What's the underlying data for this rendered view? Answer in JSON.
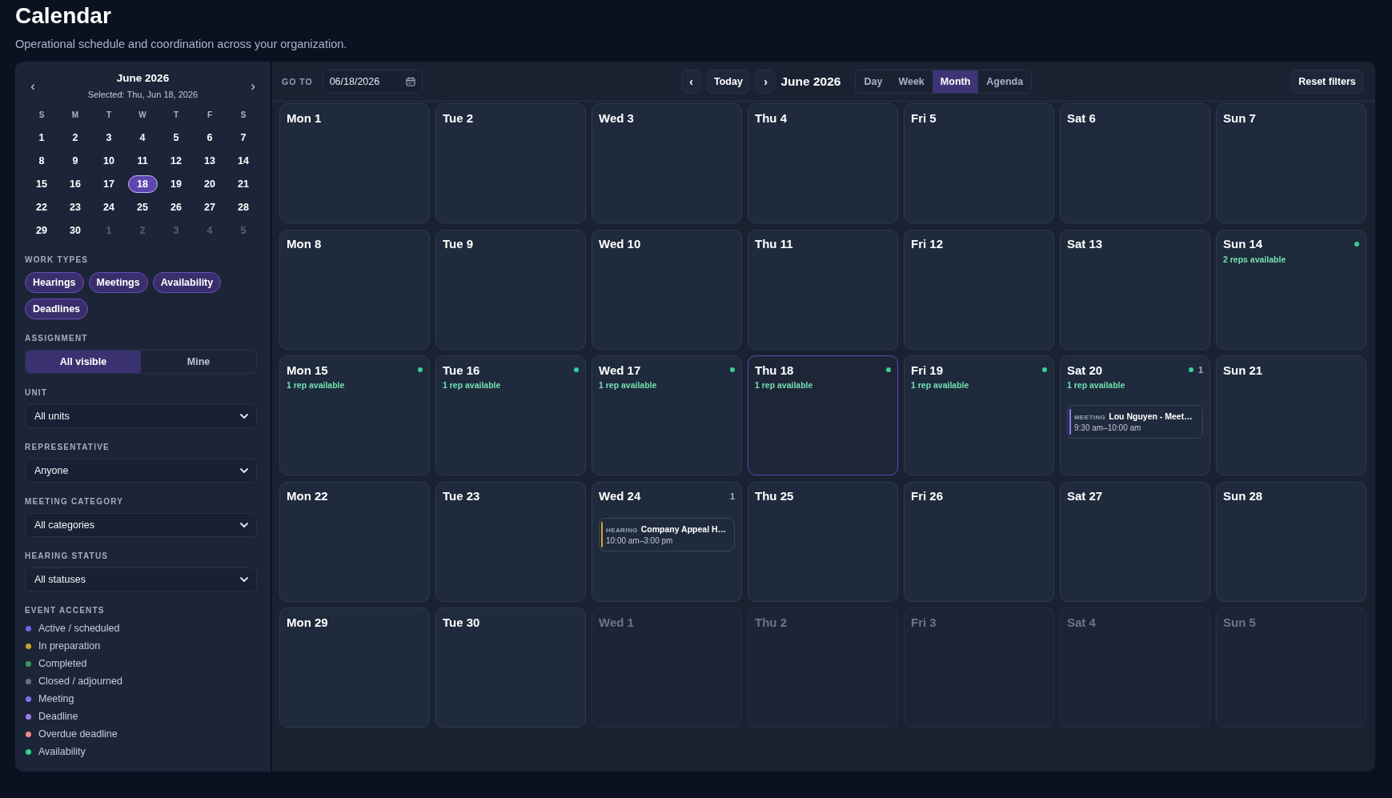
{
  "page": {
    "title": "Calendar",
    "subtitle": "Operational schedule and coordination across your organization."
  },
  "sidebar": {
    "mini_calendar": {
      "prev": "‹",
      "next": "›",
      "title": "June 2026",
      "selected_label": "Selected: Thu, Jun 18, 2026",
      "weekdays": [
        "S",
        "M",
        "T",
        "W",
        "T",
        "F",
        "S"
      ],
      "days": [
        {
          "label": "1",
          "outside_month": false,
          "selected": false
        },
        {
          "label": "2",
          "outside_month": false,
          "selected": false
        },
        {
          "label": "3",
          "outside_month": false,
          "selected": false
        },
        {
          "label": "4",
          "outside_month": false,
          "selected": false
        },
        {
          "label": "5",
          "outside_month": false,
          "selected": false
        },
        {
          "label": "6",
          "outside_month": false,
          "selected": false
        },
        {
          "label": "7",
          "outside_month": false,
          "selected": false
        },
        {
          "label": "8",
          "outside_month": false,
          "selected": false
        },
        {
          "label": "9",
          "outside_month": false,
          "selected": false
        },
        {
          "label": "10",
          "outside_month": false,
          "selected": false
        },
        {
          "label": "11",
          "outside_month": false,
          "selected": false
        },
        {
          "label": "12",
          "outside_month": false,
          "selected": false
        },
        {
          "label": "13",
          "outside_month": false,
          "selected": false
        },
        {
          "label": "14",
          "outside_month": false,
          "selected": false
        },
        {
          "label": "15",
          "outside_month": false,
          "selected": false
        },
        {
          "label": "16",
          "outside_month": false,
          "selected": false
        },
        {
          "label": "17",
          "outside_month": false,
          "selected": false
        },
        {
          "label": "18",
          "outside_month": false,
          "selected": true
        },
        {
          "label": "19",
          "outside_month": false,
          "selected": false
        },
        {
          "label": "20",
          "outside_month": false,
          "selected": false
        },
        {
          "label": "21",
          "outside_month": false,
          "selected": false
        },
        {
          "label": "22",
          "outside_month": false,
          "selected": false
        },
        {
          "label": "23",
          "outside_month": false,
          "selected": false
        },
        {
          "label": "24",
          "outside_month": false,
          "selected": false
        },
        {
          "label": "25",
          "outside_month": false,
          "selected": false
        },
        {
          "label": "26",
          "outside_month": false,
          "selected": false
        },
        {
          "label": "27",
          "outside_month": false,
          "selected": false
        },
        {
          "label": "28",
          "outside_month": false,
          "selected": false
        },
        {
          "label": "29",
          "outside_month": false,
          "selected": false
        },
        {
          "label": "30",
          "outside_month": false,
          "selected": false
        },
        {
          "label": "1",
          "outside_month": true,
          "selected": false
        },
        {
          "label": "2",
          "outside_month": true,
          "selected": false
        },
        {
          "label": "3",
          "outside_month": true,
          "selected": false
        },
        {
          "label": "4",
          "outside_month": true,
          "selected": false
        },
        {
          "label": "5",
          "outside_month": true,
          "selected": false
        }
      ]
    },
    "work_types": {
      "label": "WORK TYPES",
      "chips": [
        {
          "label": "Hearings",
          "on": true
        },
        {
          "label": "Meetings",
          "on": true
        },
        {
          "label": "Availability",
          "on": true
        },
        {
          "label": "Deadlines",
          "on": true
        }
      ]
    },
    "assignment": {
      "label": "ASSIGNMENT",
      "options": [
        {
          "label": "All visible",
          "selected": true
        },
        {
          "label": "Mine",
          "selected": false
        }
      ]
    },
    "filters": [
      {
        "label": "UNIT",
        "value": "All units"
      },
      {
        "label": "REPRESENTATIVE",
        "value": "Anyone"
      },
      {
        "label": "MEETING CATEGORY",
        "value": "All categories"
      },
      {
        "label": "HEARING STATUS",
        "value": "All statuses"
      }
    ],
    "legend": {
      "label": "EVENT ACCENTS",
      "items": [
        {
          "label": "Active / scheduled",
          "color": "#7066e8"
        },
        {
          "label": "In preparation",
          "color": "#c9a227"
        },
        {
          "label": "Completed",
          "color": "#3a9a5c"
        },
        {
          "label": "Closed / adjourned",
          "color": "#6b7280"
        },
        {
          "label": "Meeting",
          "color": "#7f72f0"
        },
        {
          "label": "Deadline",
          "color": "#a07ef0"
        },
        {
          "label": "Overdue deadline",
          "color": "#f28b8b"
        },
        {
          "label": "Availability",
          "color": "#34d399"
        }
      ]
    }
  },
  "toolbar": {
    "goto_label": "GO TO",
    "date_value": "06/18/2026",
    "prev": "‹",
    "today": "Today",
    "next": "›",
    "period": "June 2026",
    "views": [
      {
        "label": "Day",
        "selected": false
      },
      {
        "label": "Week",
        "selected": false
      },
      {
        "label": "Month",
        "selected": true
      },
      {
        "label": "Agenda",
        "selected": false
      }
    ],
    "reset": "Reset filters"
  },
  "month_grid": {
    "days": [
      {
        "label": "Mon 1",
        "outside_month": false,
        "selected": false
      },
      {
        "label": "Tue 2",
        "outside_month": false,
        "selected": false
      },
      {
        "label": "Wed 3",
        "outside_month": false,
        "selected": false
      },
      {
        "label": "Thu 4",
        "outside_month": false,
        "selected": false
      },
      {
        "label": "Fri 5",
        "outside_month": false,
        "selected": false
      },
      {
        "label": "Sat 6",
        "outside_month": false,
        "selected": false
      },
      {
        "label": "Sun 7",
        "outside_month": false,
        "selected": false
      },
      {
        "label": "Mon 8",
        "outside_month": false,
        "selected": false
      },
      {
        "label": "Tue 9",
        "outside_month": false,
        "selected": false
      },
      {
        "label": "Wed 10",
        "outside_month": false,
        "selected": false
      },
      {
        "label": "Thu 11",
        "outside_month": false,
        "selected": false
      },
      {
        "label": "Fri 12",
        "outside_month": false,
        "selected": false
      },
      {
        "label": "Sat 13",
        "outside_month": false,
        "selected": false
      },
      {
        "label": "Sun 14",
        "outside_month": false,
        "selected": false,
        "availability": "2 reps available"
      },
      {
        "label": "Mon 15",
        "outside_month": false,
        "selected": false,
        "availability": "1 rep available"
      },
      {
        "label": "Tue 16",
        "outside_month": false,
        "selected": false,
        "availability": "1 rep available"
      },
      {
        "label": "Wed 17",
        "outside_month": false,
        "selected": false,
        "availability": "1 rep available"
      },
      {
        "label": "Thu 18",
        "outside_month": false,
        "selected": true,
        "availability": "1 rep available"
      },
      {
        "label": "Fri 19",
        "outside_month": false,
        "selected": false,
        "availability": "1 rep available"
      },
      {
        "label": "Sat 20",
        "outside_month": false,
        "selected": false,
        "availability": "1 rep available",
        "count": "1",
        "events": [
          {
            "type_label": "MEETING",
            "title": "Lou Nguyen - Meet…",
            "time": "9:30 am–10:00 am",
            "color": "#8b7cf6"
          }
        ]
      },
      {
        "label": "Sun 21",
        "outside_month": false,
        "selected": false
      },
      {
        "label": "Mon 22",
        "outside_month": false,
        "selected": false
      },
      {
        "label": "Tue 23",
        "outside_month": false,
        "selected": false
      },
      {
        "label": "Wed 24",
        "outside_month": false,
        "selected": false,
        "count": "1",
        "events": [
          {
            "type_label": "HEARING",
            "title": "Company Appeal H…",
            "time": "10:00 am–3:00 pm",
            "color": "#d4a72c"
          }
        ]
      },
      {
        "label": "Thu 25",
        "outside_month": false,
        "selected": false
      },
      {
        "label": "Fri 26",
        "outside_month": false,
        "selected": false
      },
      {
        "label": "Sat 27",
        "outside_month": false,
        "selected": false
      },
      {
        "label": "Sun 28",
        "outside_month": false,
        "selected": false
      },
      {
        "label": "Mon 29",
        "outside_month": false,
        "selected": false
      },
      {
        "label": "Tue 30",
        "outside_month": false,
        "selected": false
      },
      {
        "label": "Wed 1",
        "outside_month": true,
        "selected": false
      },
      {
        "label": "Thu 2",
        "outside_month": true,
        "selected": false
      },
      {
        "label": "Fri 3",
        "outside_month": true,
        "selected": false
      },
      {
        "label": "Sat 4",
        "outside_month": true,
        "selected": false
      },
      {
        "label": "Sun 5",
        "outside_month": true,
        "selected": false
      }
    ]
  }
}
